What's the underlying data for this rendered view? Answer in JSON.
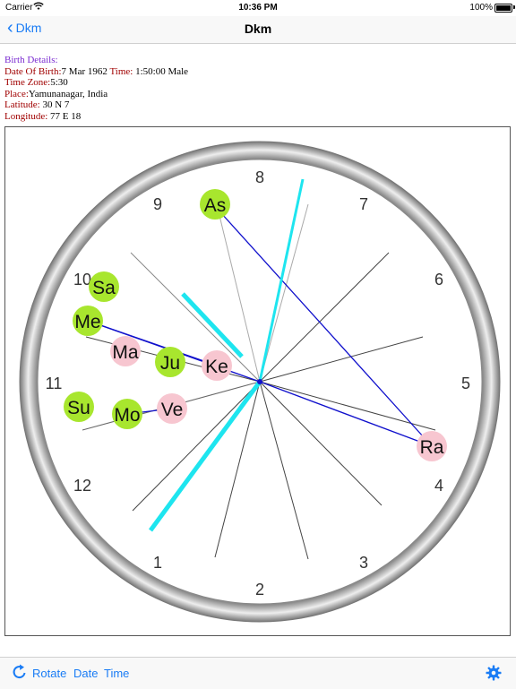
{
  "status_bar": {
    "carrier": "Carrier",
    "time": "10:36 PM",
    "battery": "100%"
  },
  "nav": {
    "back_label": "Dkm",
    "title": "Dkm"
  },
  "birth_details": {
    "heading": "Birth Details:",
    "dob_label": "Date Of Birth:",
    "dob_value": "7 Mar 1962",
    "time_label": "Time:",
    "time_value": "1:50:00 Male",
    "tz_label": "Time Zone:",
    "tz_value": "5:30",
    "place_label": "Place:",
    "place_value": "Yamunanagar, India",
    "lat_label": "Latitude:",
    "lat_value": "30 N 7",
    "lon_label": "Longitude:",
    "lon_value": "77 E 18"
  },
  "dial": {
    "numbers": [
      "1",
      "2",
      "3",
      "4",
      "5",
      "6",
      "7",
      "8",
      "9",
      "10",
      "11",
      "12"
    ],
    "planets": [
      {
        "label": "As",
        "color": "#a8e62e"
      },
      {
        "label": "Sa",
        "color": "#a8e62e"
      },
      {
        "label": "Me",
        "color": "#a8e62e"
      },
      {
        "label": "Ma",
        "color": "#f7c6d0"
      },
      {
        "label": "Ju",
        "color": "#a8e62e"
      },
      {
        "label": "Ke",
        "color": "#f7c6d0"
      },
      {
        "label": "Su",
        "color": "#a8e62e"
      },
      {
        "label": "Mo",
        "color": "#a8e62e"
      },
      {
        "label": "Ve",
        "color": "#f7c6d0"
      },
      {
        "label": "Ra",
        "color": "#f7c6d0"
      }
    ],
    "hand_color": "#1ee5ef",
    "aspect_line_color": "#1010cc"
  },
  "toolbar": {
    "rotate_label": "Rotate",
    "date_label": "Date",
    "time_label": "Time",
    "accent": "#1a7cf5"
  }
}
